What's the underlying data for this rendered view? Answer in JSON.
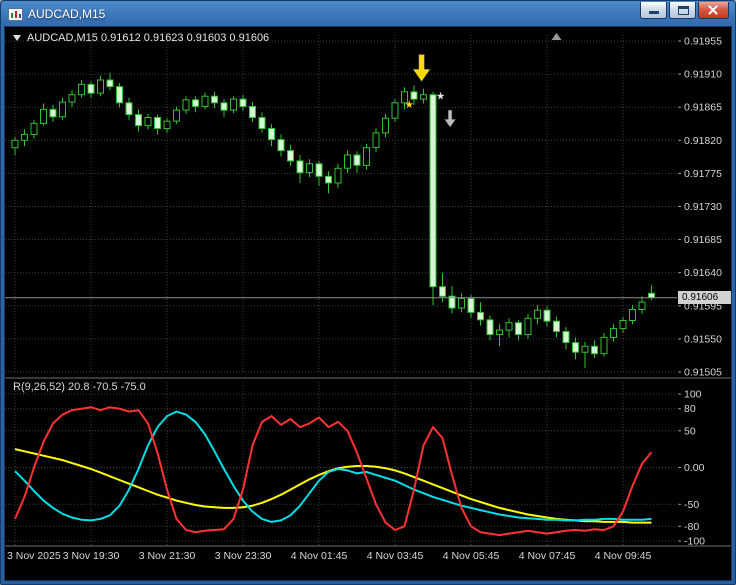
{
  "window": {
    "title": "AUDCAD,M15"
  },
  "chart_data": {
    "type": "candlestick+oscillator",
    "symbol": "AUDCAD",
    "timeframe": "M15",
    "ohlc_label": "AUDCAD,M15 0.91612 0.91623 0.91603 0.91606",
    "price_axis": {
      "max": 0.91955,
      "min": 0.91505,
      "labels": [
        "0.91955",
        "0.91910",
        "0.91865",
        "0.91820",
        "0.91775",
        "0.91730",
        "0.91685",
        "0.91640",
        "0.91595",
        "0.91550",
        "0.91505"
      ]
    },
    "bid": {
      "price": 0.91606,
      "label": "0.91606"
    },
    "time_axis": [
      {
        "label": "3 Nov 2025",
        "bar": 0
      },
      {
        "label": "3 Nov 19:30",
        "bar": 8
      },
      {
        "label": "3 Nov 21:30",
        "bar": 16
      },
      {
        "label": "3 Nov 23:30",
        "bar": 24
      },
      {
        "label": "4 Nov 01:45",
        "bar": 32
      },
      {
        "label": "4 Nov 03:45",
        "bar": 40
      },
      {
        "label": "4 Nov 05:45",
        "bar": 48
      },
      {
        "label": "4 Nov 07:45",
        "bar": 56
      },
      {
        "label": "4 Nov 09:45",
        "bar": 64
      }
    ],
    "candles": [
      [
        0.9181,
        0.91825,
        0.918,
        0.9182
      ],
      [
        0.9182,
        0.91835,
        0.91812,
        0.91828
      ],
      [
        0.91828,
        0.91848,
        0.91822,
        0.91843
      ],
      [
        0.91843,
        0.9187,
        0.9184,
        0.91862
      ],
      [
        0.91862,
        0.91868,
        0.91845,
        0.91852
      ],
      [
        0.91852,
        0.91878,
        0.91848,
        0.91872
      ],
      [
        0.91872,
        0.91888,
        0.91865,
        0.91882
      ],
      [
        0.91882,
        0.91902,
        0.91878,
        0.91896
      ],
      [
        0.91896,
        0.919,
        0.91878,
        0.91884
      ],
      [
        0.91884,
        0.91908,
        0.9188,
        0.91902
      ],
      [
        0.91902,
        0.91912,
        0.91888,
        0.91893
      ],
      [
        0.91893,
        0.91898,
        0.91865,
        0.91871
      ],
      [
        0.91871,
        0.91878,
        0.91848,
        0.91855
      ],
      [
        0.91855,
        0.91862,
        0.91832,
        0.9184
      ],
      [
        0.9184,
        0.91856,
        0.91835,
        0.91851
      ],
      [
        0.91851,
        0.91855,
        0.91828,
        0.91836
      ],
      [
        0.91836,
        0.9185,
        0.9183,
        0.91846
      ],
      [
        0.91846,
        0.91866,
        0.91842,
        0.91861
      ],
      [
        0.91861,
        0.9188,
        0.91856,
        0.91875
      ],
      [
        0.91875,
        0.9188,
        0.91858,
        0.91866
      ],
      [
        0.91866,
        0.91885,
        0.91862,
        0.9188
      ],
      [
        0.9188,
        0.91886,
        0.91864,
        0.91871
      ],
      [
        0.91871,
        0.91876,
        0.91852,
        0.91861
      ],
      [
        0.91861,
        0.9188,
        0.91857,
        0.91876
      ],
      [
        0.91876,
        0.91882,
        0.9186,
        0.91866
      ],
      [
        0.91866,
        0.91872,
        0.91845,
        0.91851
      ],
      [
        0.91851,
        0.91858,
        0.9183,
        0.91836
      ],
      [
        0.91836,
        0.91842,
        0.91812,
        0.91821
      ],
      [
        0.91821,
        0.91828,
        0.91798,
        0.91806
      ],
      [
        0.91806,
        0.91814,
        0.91785,
        0.91792
      ],
      [
        0.91792,
        0.918,
        0.91762,
        0.91776
      ],
      [
        0.91776,
        0.91794,
        0.9177,
        0.91788
      ],
      [
        0.91788,
        0.91792,
        0.91758,
        0.91771
      ],
      [
        0.91771,
        0.91778,
        0.91748,
        0.91762
      ],
      [
        0.91762,
        0.91788,
        0.91755,
        0.91782
      ],
      [
        0.91782,
        0.91806,
        0.91776,
        0.918
      ],
      [
        0.918,
        0.91805,
        0.91776,
        0.91786
      ],
      [
        0.91786,
        0.91815,
        0.9178,
        0.9181
      ],
      [
        0.9181,
        0.91836,
        0.91804,
        0.9183
      ],
      [
        0.9183,
        0.91856,
        0.91824,
        0.9185
      ],
      [
        0.9185,
        0.91876,
        0.91845,
        0.91871
      ],
      [
        0.91871,
        0.91892,
        0.91862,
        0.91886
      ],
      [
        0.91886,
        0.91895,
        0.91868,
        0.91876
      ],
      [
        0.91876,
        0.9189,
        0.9187,
        0.91882
      ],
      [
        0.91882,
        0.91886,
        0.91596,
        0.91621
      ],
      [
        0.91621,
        0.9164,
        0.916,
        0.91608
      ],
      [
        0.91608,
        0.91622,
        0.91585,
        0.91592
      ],
      [
        0.91592,
        0.91612,
        0.91586,
        0.91605
      ],
      [
        0.91605,
        0.9161,
        0.91578,
        0.91586
      ],
      [
        0.91586,
        0.916,
        0.91568,
        0.91576
      ],
      [
        0.91576,
        0.91582,
        0.91548,
        0.91556
      ],
      [
        0.91556,
        0.9157,
        0.9154,
        0.91562
      ],
      [
        0.91562,
        0.91578,
        0.91552,
        0.91572
      ],
      [
        0.91572,
        0.91576,
        0.91548,
        0.91556
      ],
      [
        0.91556,
        0.91584,
        0.9155,
        0.91578
      ],
      [
        0.91578,
        0.91596,
        0.9157,
        0.91589
      ],
      [
        0.91589,
        0.91594,
        0.91566,
        0.91574
      ],
      [
        0.91574,
        0.9158,
        0.91552,
        0.9156
      ],
      [
        0.9156,
        0.91566,
        0.91536,
        0.91545
      ],
      [
        0.91545,
        0.91552,
        0.91522,
        0.91532
      ],
      [
        0.91532,
        0.91546,
        0.9151,
        0.9154
      ],
      [
        0.9154,
        0.91548,
        0.91524,
        0.9153
      ],
      [
        0.9153,
        0.91558,
        0.91526,
        0.91552
      ],
      [
        0.91552,
        0.9157,
        0.91546,
        0.91564
      ],
      [
        0.91564,
        0.9158,
        0.91558,
        0.91575
      ],
      [
        0.91575,
        0.91596,
        0.9157,
        0.9159
      ],
      [
        0.9159,
        0.91608,
        0.91584,
        0.916
      ],
      [
        0.91612,
        0.91623,
        0.91603,
        0.91606
      ]
    ],
    "indicator": {
      "label": "R(9,26,52) 20.8 -70.5 -75.0",
      "axis_labels": [
        "100",
        "80",
        "50",
        "0.00",
        "-50",
        "-80",
        "-100"
      ],
      "series": [
        {
          "name": "red",
          "color": "#ff3333",
          "values": [
            -70,
            -40,
            0,
            35,
            60,
            72,
            78,
            80,
            82,
            78,
            82,
            80,
            76,
            78,
            60,
            20,
            -30,
            -70,
            -85,
            -88,
            -86,
            -85,
            -84,
            -70,
            -30,
            30,
            62,
            70,
            58,
            66,
            55,
            60,
            68,
            55,
            62,
            50,
            20,
            -15,
            -50,
            -75,
            -85,
            -80,
            -30,
            30,
            55,
            40,
            -10,
            -55,
            -80,
            -88,
            -90,
            -92,
            -90,
            -88,
            -86,
            -88,
            -90,
            -88,
            -86,
            -85,
            -86,
            -84,
            -85,
            -80,
            -60,
            -25,
            5,
            21
          ]
        },
        {
          "name": "cyan",
          "color": "#00dfe8",
          "values": [
            -5,
            -18,
            -32,
            -45,
            -55,
            -63,
            -68,
            -71,
            -72,
            -70,
            -65,
            -52,
            -30,
            -2,
            30,
            55,
            70,
            76,
            72,
            62,
            45,
            22,
            -2,
            -25,
            -45,
            -60,
            -70,
            -74,
            -72,
            -65,
            -52,
            -35,
            -18,
            -6,
            -2,
            -4,
            -8,
            -6,
            -10,
            -14,
            -18,
            -24,
            -30,
            -35,
            -40,
            -44,
            -48,
            -52,
            -55,
            -58,
            -61,
            -64,
            -66,
            -68,
            -69,
            -70,
            -71,
            -71,
            -72,
            -72,
            -71,
            -71,
            -70,
            -70,
            -71,
            -71,
            -71,
            -70
          ]
        },
        {
          "name": "yellow",
          "color": "#ffff00",
          "values": [
            25,
            22,
            19,
            16,
            13,
            10,
            6,
            2,
            -2,
            -7,
            -12,
            -17,
            -22,
            -27,
            -32,
            -37,
            -41,
            -45,
            -48,
            -51,
            -53,
            -54,
            -55,
            -55,
            -54,
            -52,
            -48,
            -43,
            -37,
            -30,
            -23,
            -16,
            -10,
            -5,
            -1,
            1,
            2,
            2,
            1,
            -1,
            -4,
            -8,
            -13,
            -18,
            -23,
            -28,
            -33,
            -38,
            -43,
            -47,
            -51,
            -55,
            -58,
            -61,
            -64,
            -66,
            -68,
            -70,
            -71,
            -72,
            -73,
            -73,
            -74,
            -74,
            -74,
            -75,
            -75,
            -75
          ]
        }
      ]
    },
    "annotations": [
      {
        "type": "star",
        "bar": 41.5,
        "price": 0.9187,
        "size": 13,
        "color": "#ffd800",
        "name": "signal-star-yellow"
      },
      {
        "type": "arrow-down",
        "bar": 42.8,
        "price": 0.919,
        "w": 17,
        "h": 27,
        "color": "#ffd800",
        "name": "signal-arrow-down-yellow"
      },
      {
        "type": "star",
        "bar": 44.8,
        "price": 0.9188,
        "size": 9,
        "color": "#e0e0e0",
        "name": "signal-star-white"
      },
      {
        "type": "arrow-down",
        "bar": 45.8,
        "price": 0.91838,
        "w": 11,
        "h": 17,
        "color": "#bdbdbd",
        "name": "signal-arrow-down-silver"
      },
      {
        "type": "shift-marker",
        "bar": 57,
        "name": "chart-shift-marker"
      }
    ],
    "colors": {
      "background": "#000000",
      "grid": "#414141",
      "candle_border": "#30c230",
      "bull_fill": "#000000",
      "bear_fill": "#d6f6d6",
      "bid_line": "#8e8e8e",
      "axis_text": "#d6d6d6",
      "separator": "#6f6f6f"
    }
  }
}
